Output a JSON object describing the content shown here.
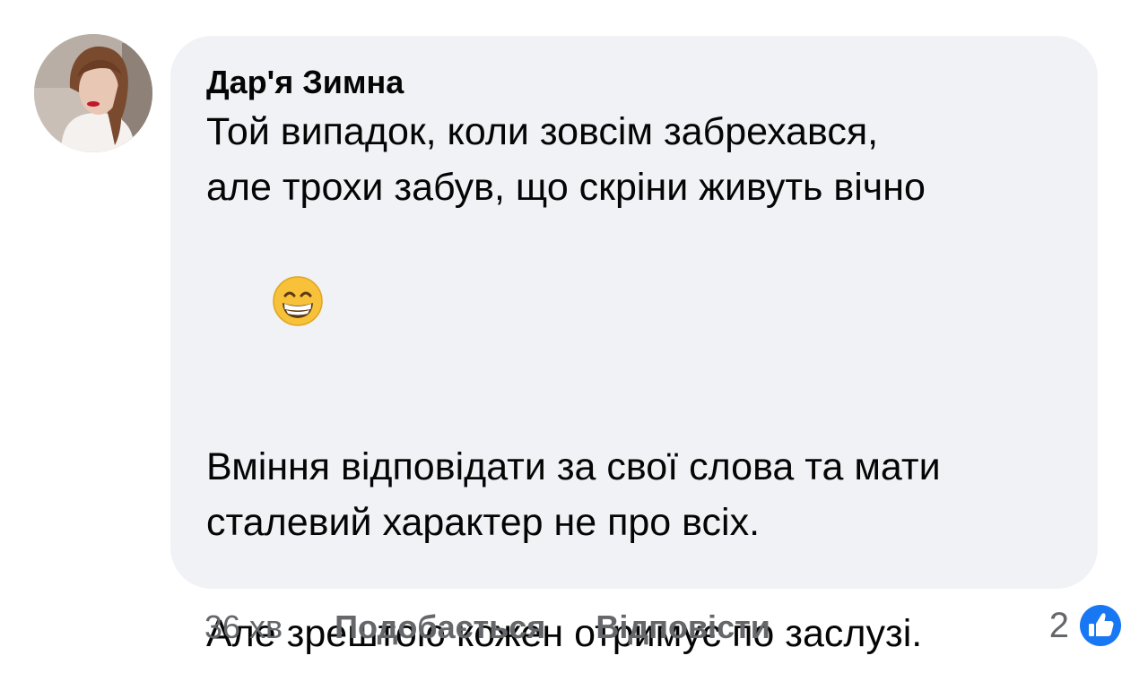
{
  "comment": {
    "author": "Дар'я Зимна",
    "lines": [
      "Той випадок, коли зовсім забрехався,",
      "але трохи забув, що скріни живуть вічно"
    ],
    "emoji": "grinning-face-emoji",
    "paragraph2": [
      "Вміння відповідати за свої слова та мати",
      "сталевий характер не про всіх."
    ],
    "paragraph3": "Але зрештою кожен отримує по заслузі."
  },
  "footer": {
    "time": "36 хв",
    "like_label": "Подобається",
    "reply_label": "Відповісти",
    "reaction_count": "2",
    "reaction_icon": "like-icon"
  },
  "colors": {
    "bubble": "#f0f2f5",
    "text": "#050505",
    "muted": "#65676b",
    "like_blue": "#1877f2"
  }
}
